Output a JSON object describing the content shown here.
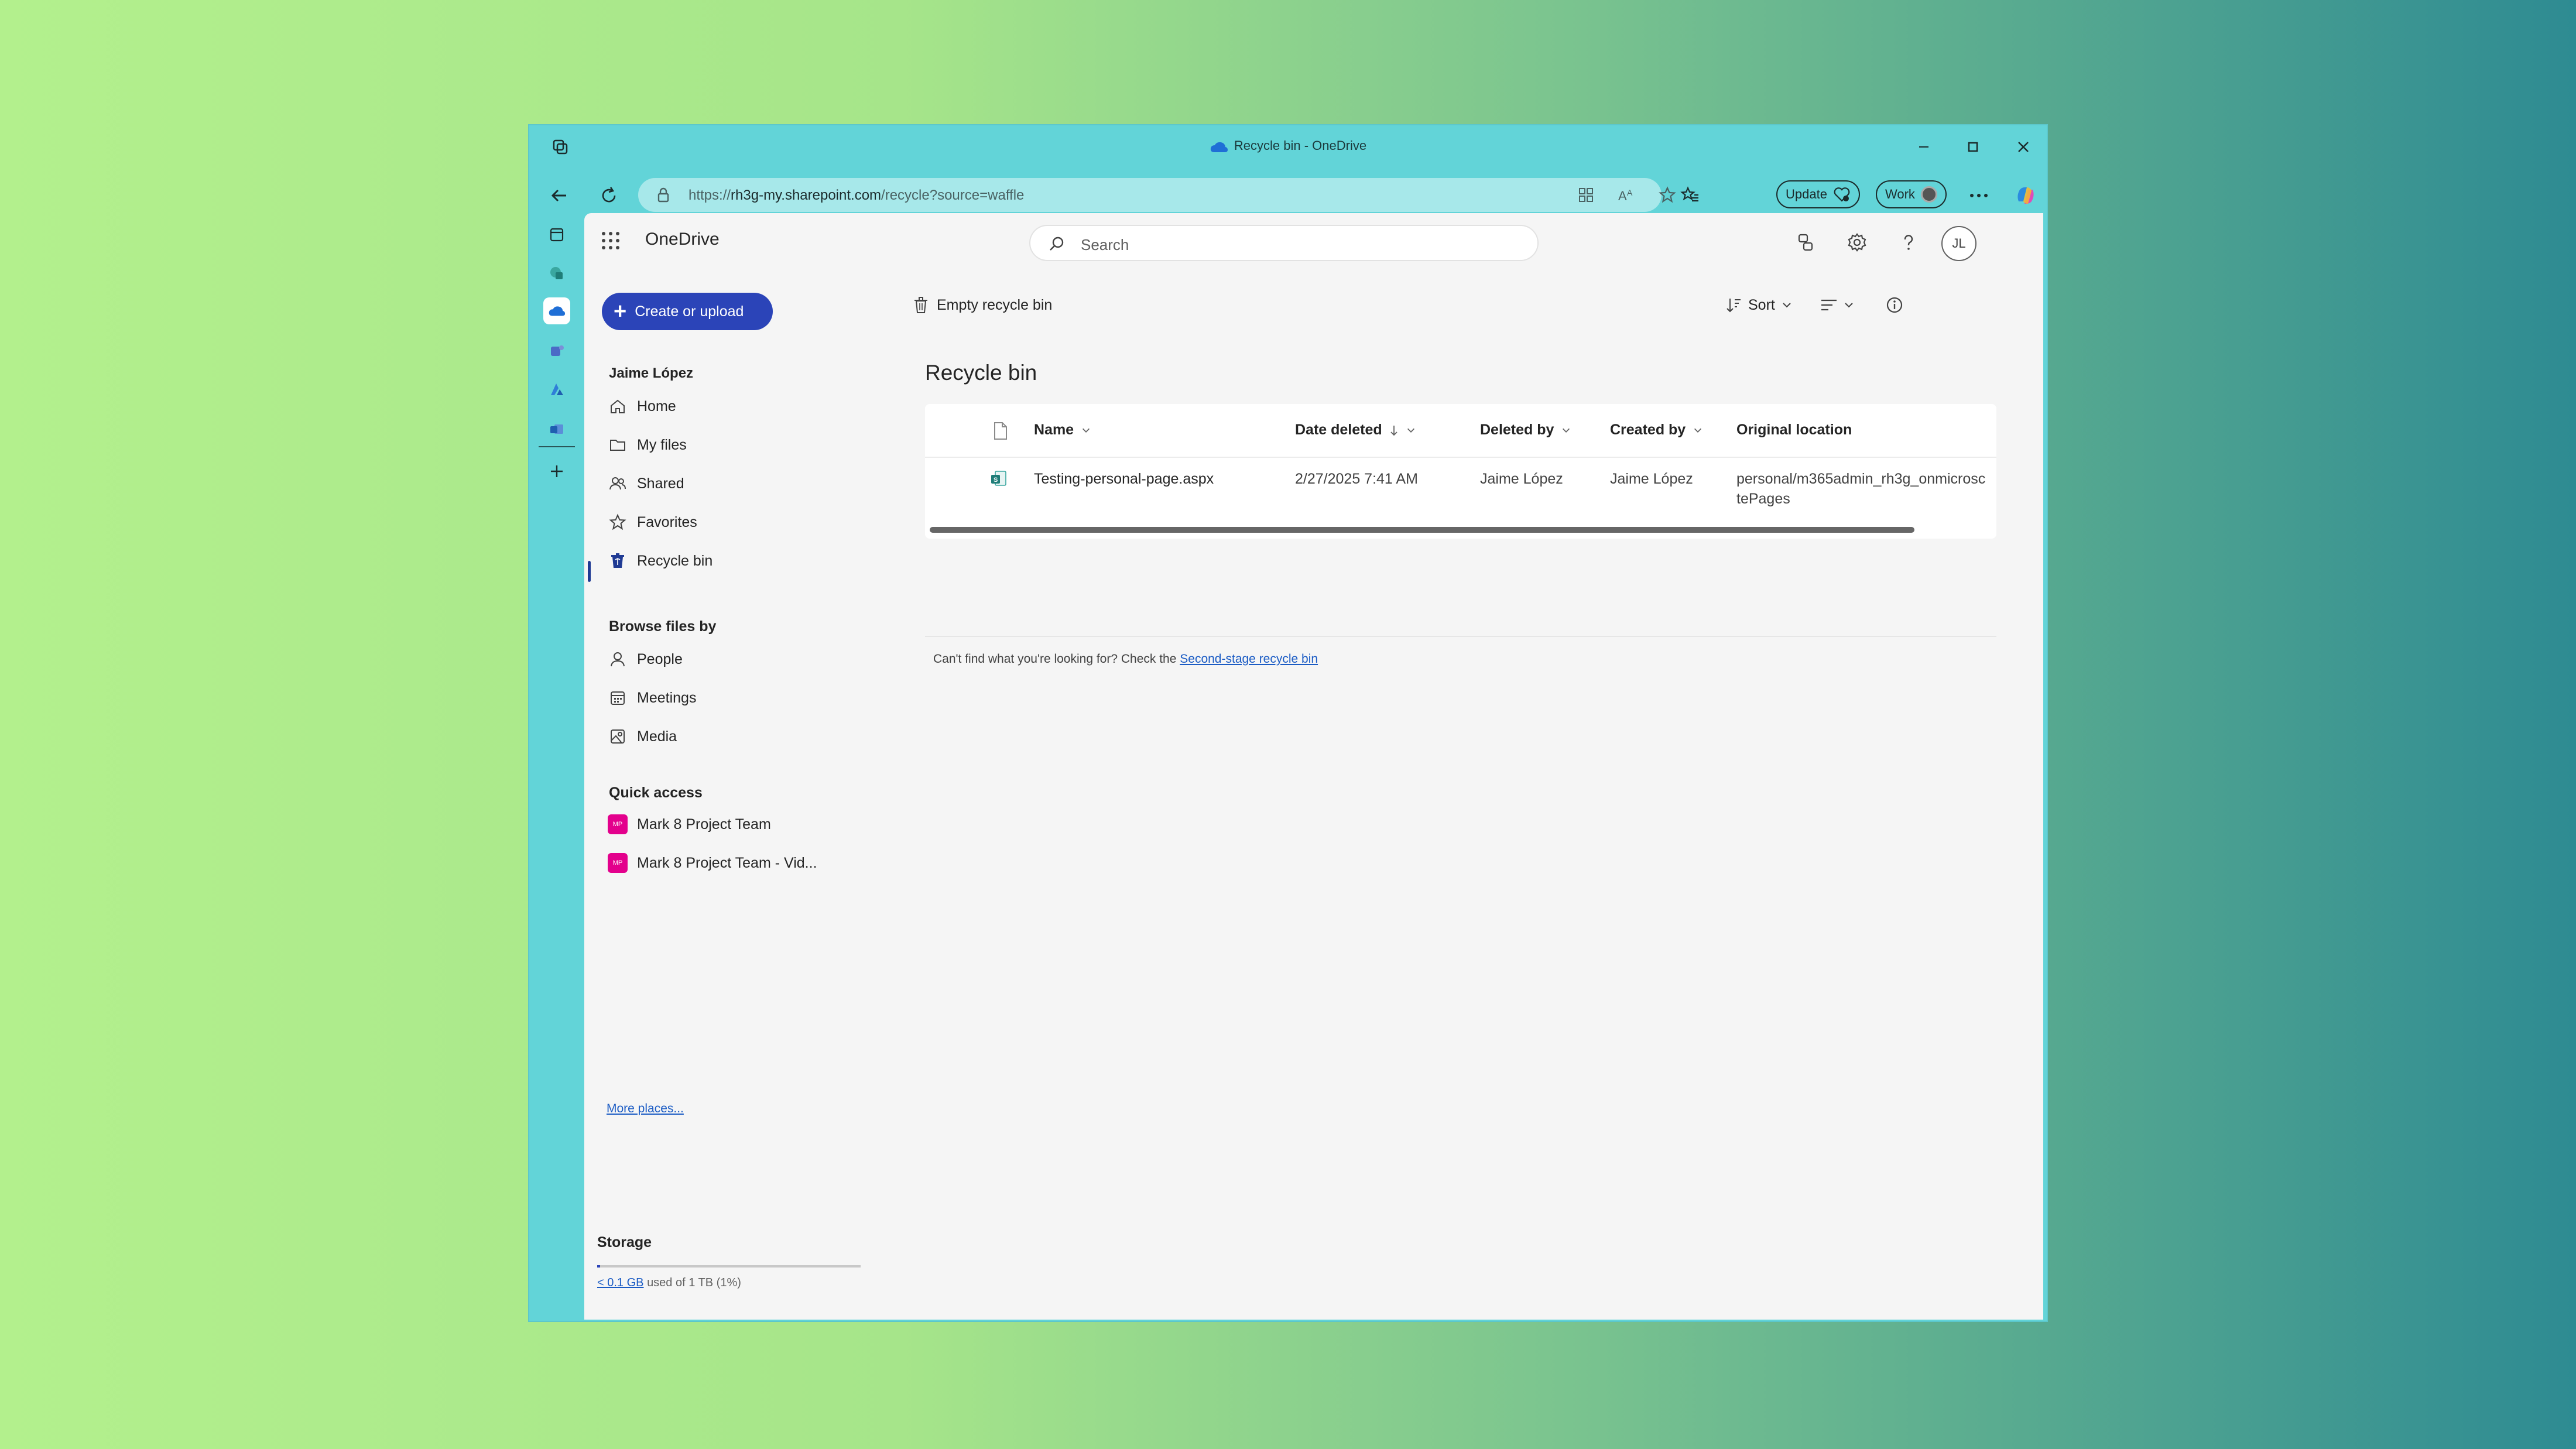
{
  "browser": {
    "window_title": "Recycle bin - OneDrive",
    "url_prefix": "https://",
    "url_domain": "rh3g-my.sharepoint.com",
    "url_path": "/recycle?source=waffle",
    "update_label": "Update",
    "profile_label": "Work"
  },
  "app": {
    "name": "OneDrive",
    "search_placeholder": "Search",
    "avatar_initials": "JL"
  },
  "sidebar": {
    "create_label": "Create or upload",
    "user_name": "Jaime López",
    "items": [
      {
        "label": "Home",
        "icon": "home-icon"
      },
      {
        "label": "My files",
        "icon": "folder-icon"
      },
      {
        "label": "Shared",
        "icon": "people-icon"
      },
      {
        "label": "Favorites",
        "icon": "star-icon"
      },
      {
        "label": "Recycle bin",
        "icon": "recycle-bin-icon",
        "active": true
      }
    ],
    "browse_title": "Browse files by",
    "browse_items": [
      {
        "label": "People",
        "icon": "person-icon"
      },
      {
        "label": "Meetings",
        "icon": "calendar-icon"
      },
      {
        "label": "Media",
        "icon": "image-icon"
      }
    ],
    "quick_title": "Quick access",
    "quick_items": [
      {
        "label": "Mark 8 Project Team",
        "badge": "MP"
      },
      {
        "label": "Mark 8 Project Team - Vid...",
        "badge": "MP"
      }
    ],
    "more_places": "More places...",
    "storage": {
      "title": "Storage",
      "used_link": "< 0.1 GB",
      "used_text": "used of 1 TB (1%)",
      "percent": 1
    }
  },
  "commands": {
    "empty_bin": "Empty recycle bin",
    "sort": "Sort"
  },
  "page": {
    "title": "Recycle bin",
    "columns": [
      "Name",
      "Date deleted",
      "Deleted by",
      "Created by",
      "Original location"
    ],
    "rows": [
      {
        "name": "Testing-personal-page.aspx",
        "date_deleted": "2/27/2025 7:41 AM",
        "deleted_by": "Jaime López",
        "created_by": "Jaime López",
        "location_line1": "personal/m365admin_rh3g_onmicrosc",
        "location_line2": "tePages"
      }
    ],
    "help_text": "Can't find what you're looking for? Check the ",
    "help_link": "Second-stage recycle bin"
  },
  "colors": {
    "accent": "#2b44b8",
    "window_frame": "#62d4d8",
    "quick_access_badge": "#e3008c"
  }
}
